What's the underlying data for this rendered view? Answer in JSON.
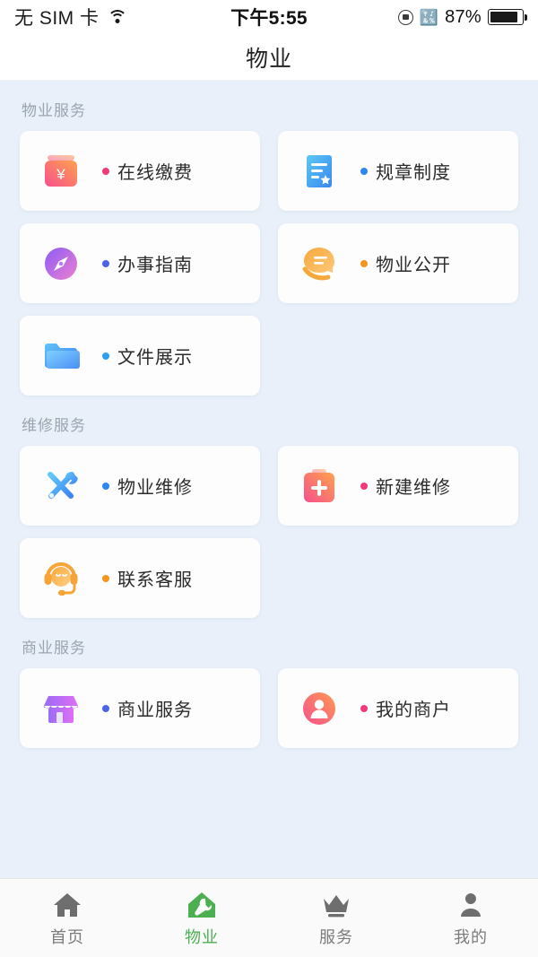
{
  "status_bar": {
    "carrier": "无 SIM 卡",
    "wifi_icon": "wifi-icon",
    "time": "下午5:55",
    "rotation_lock_icon": "rotation-lock-icon",
    "bluetooth_icon": "bluetooth-icon",
    "battery_percent": "87%",
    "battery_icon": "battery-icon"
  },
  "navbar": {
    "title": "物业"
  },
  "sections": [
    {
      "title": "物业服务",
      "items": [
        {
          "label": "在线缴费",
          "icon": "money-jar-icon",
          "dot_color": "#f0397a"
        },
        {
          "label": "规章制度",
          "icon": "document-star-icon",
          "dot_color": "#2e86f0"
        },
        {
          "label": "办事指南",
          "icon": "compass-icon",
          "dot_color": "#4a63e8"
        },
        {
          "label": "物业公开",
          "icon": "speech-hand-icon",
          "dot_color": "#f5951e"
        },
        {
          "label": "文件展示",
          "icon": "folder-icon",
          "dot_color": "#2e9ef0"
        }
      ]
    },
    {
      "title": "维修服务",
      "items": [
        {
          "label": "物业维修",
          "icon": "tools-icon",
          "dot_color": "#2e86f0"
        },
        {
          "label": "新建维修",
          "icon": "clipboard-plus-icon",
          "dot_color": "#f0397a"
        },
        {
          "label": "联系客服",
          "icon": "headset-support-icon",
          "dot_color": "#f5951e"
        }
      ]
    },
    {
      "title": "商业服务",
      "items": [
        {
          "label": "商业服务",
          "icon": "shop-icon",
          "dot_color": "#4a63e8"
        },
        {
          "label": "我的商户",
          "icon": "merchant-avatar-icon",
          "dot_color": "#f0397a"
        }
      ]
    }
  ],
  "tabbar": {
    "active_color": "#4caf50",
    "inactive_color": "#7b7b7b",
    "tabs": [
      {
        "label": "首页",
        "icon": "home-icon",
        "active": false
      },
      {
        "label": "物业",
        "icon": "house-wrench-icon",
        "active": true
      },
      {
        "label": "服务",
        "icon": "crown-icon",
        "active": false
      },
      {
        "label": "我的",
        "icon": "person-icon",
        "active": false
      }
    ]
  }
}
